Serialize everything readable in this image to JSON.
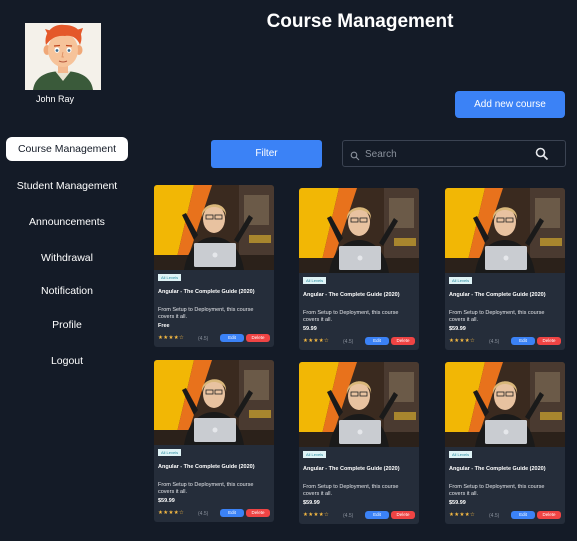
{
  "user": {
    "name": "John Ray"
  },
  "sidebar": {
    "items": [
      {
        "label": "Course Management",
        "active": true
      },
      {
        "label": "Student Management",
        "active": false
      },
      {
        "label": "Announcements",
        "active": false
      },
      {
        "label": "Withdrawal",
        "active": false
      },
      {
        "label": "Notification",
        "active": false
      },
      {
        "label": "Profile",
        "active": false
      },
      {
        "label": "Logout",
        "active": false
      }
    ]
  },
  "header": {
    "title": "Course Management",
    "add_button": "Add new course"
  },
  "toolbar": {
    "filter_button": "Filter",
    "search_placeholder": "Search"
  },
  "courses": [
    {
      "level": "All Levels",
      "title": "Angular - The Complete Guide (2020)",
      "description": "From Setup to Deployment, this course covers it all.",
      "price": "Free",
      "stars": "★★★★☆",
      "rating": "(4.5)",
      "edit": "Edit",
      "delete": "Delete"
    },
    {
      "level": "All Levels",
      "title": "Angular - The Complete Guide (2020)",
      "description": "From Setup to Deployment, this course covers it all.",
      "price": "59.99",
      "stars": "★★★★☆",
      "rating": "(4.5)",
      "edit": "Edit",
      "delete": "Delete"
    },
    {
      "level": "All Levels",
      "title": "Angular - The Complete Guide (2020)",
      "description": "From Setup to Deployment, this course covers it all.",
      "price": "$59.99",
      "stars": "★★★★☆",
      "rating": "(4.5)",
      "edit": "Edit",
      "delete": "Delete"
    },
    {
      "level": "All Levels",
      "title": "Angular - The Complete Guide (2020)",
      "description": "From Setup to Deployment, this course covers it all.",
      "price": "$59.99",
      "stars": "★★★★☆",
      "rating": "(4.5)",
      "edit": "Edit",
      "delete": "Delete"
    },
    {
      "level": "All Levels",
      "title": "Angular - The Complete Guide (2020)",
      "description": "From Setup to Deployment, this course covers it all.",
      "price": "$59.99",
      "stars": "★★★★☆",
      "rating": "(4.5)",
      "edit": "Edit",
      "delete": "Delete"
    },
    {
      "level": "All Levels",
      "title": "Angular - The Complete Guide (2020)",
      "description": "From Setup to Deployment, this course covers it all.",
      "price": "$59.99",
      "stars": "★★★★☆",
      "rating": "(4.5)",
      "edit": "Edit",
      "delete": "Delete"
    }
  ],
  "colors": {
    "background": "#141b27",
    "card": "#252d3a",
    "accent": "#3b82f6",
    "danger": "#ef4444",
    "star": "#f5b942"
  },
  "icons": {
    "search_left": "search-icon",
    "search_right": "search-icon"
  }
}
